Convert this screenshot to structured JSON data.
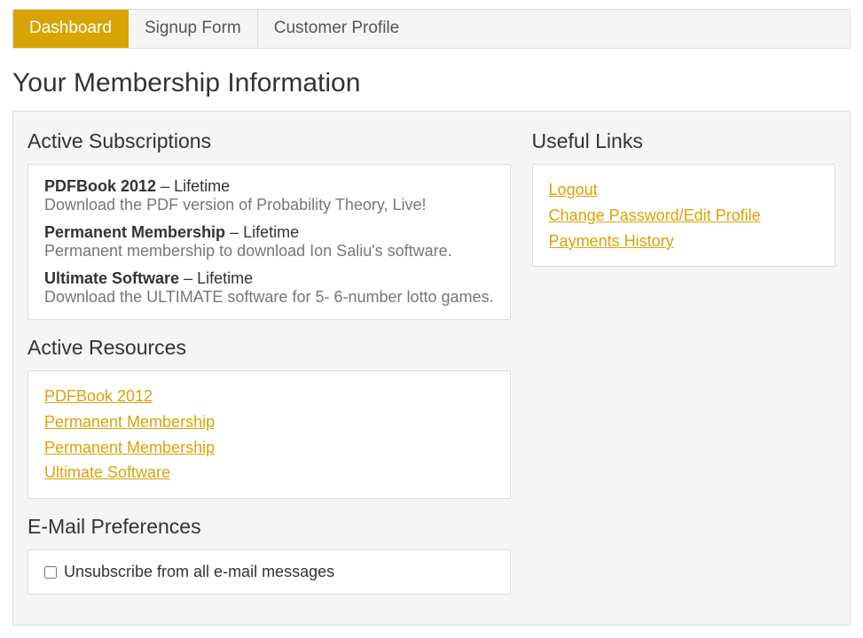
{
  "tabs": [
    {
      "label": "Dashboard",
      "active": true
    },
    {
      "label": "Signup Form",
      "active": false
    },
    {
      "label": "Customer Profile",
      "active": false
    }
  ],
  "page_title": "Your Membership Information",
  "left": {
    "active_subscriptions": {
      "title": "Active Subscriptions",
      "items": [
        {
          "name": "PDFBook 2012",
          "sep": " – ",
          "term": "Lifetime",
          "desc": "Download the PDF version of Probability Theory, Live!"
        },
        {
          "name": "Permanent Membership",
          "sep": " – ",
          "term": "Lifetime",
          "desc": "Permanent membership to download Ion Saliu's software."
        },
        {
          "name": "Ultimate Software",
          "sep": " – ",
          "term": "Lifetime",
          "desc": "Download the ULTIMATE software for 5- 6-number lotto games."
        }
      ]
    },
    "active_resources": {
      "title": "Active Resources",
      "items": [
        {
          "label": "PDFBook 2012"
        },
        {
          "label": "Permanent Membership"
        },
        {
          "label": "Permanent Membership"
        },
        {
          "label": "Ultimate Software"
        }
      ]
    },
    "email_prefs": {
      "title": "E-Mail Preferences",
      "unsubscribe_label": "Unsubscribe from all e-mail messages",
      "unsubscribe_checked": false
    }
  },
  "right": {
    "useful_links": {
      "title": "Useful Links",
      "items": [
        {
          "label": "Logout"
        },
        {
          "label": "Change Password/Edit Profile"
        },
        {
          "label": "Payments History"
        }
      ]
    }
  }
}
